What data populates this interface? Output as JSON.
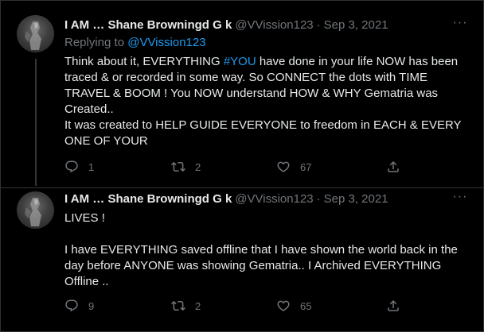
{
  "tweets": [
    {
      "author": {
        "name": "I AM … Shane Browningd G k",
        "handle": "@VVission123"
      },
      "separator": "·",
      "date": "Sep 3, 2021",
      "more_label": "···",
      "replying": {
        "prefix": "Replying to ",
        "mention": "@VVission123"
      },
      "text": {
        "before_hashtag": "Think about it, EVERYTHING ",
        "hashtag": "#YOU",
        "after_hashtag": " have done in your life NOW has been\ntraced & or recorded in some way. So CONNECT the dots with TIME\nTRAVEL & BOOM ! You NOW understand HOW & WHY Gematria was\nCreated..\nIt was created to HELP GUIDE EVERYONE to freedom in EACH & EVERY\nONE OF YOUR"
      },
      "actions": {
        "replies": "1",
        "retweets": "2",
        "likes": "67"
      }
    },
    {
      "author": {
        "name": "I AM … Shane Browningd G k",
        "handle": "@VVission123"
      },
      "separator": "·",
      "date": "Sep 3, 2021",
      "more_label": "···",
      "text": {
        "body": "LIVES !\n\nI have EVERYTHING saved offline that I have shown the world back in the\nday before ANYONE was showing Gematria.. I Archived EVERYTHING\nOffline .."
      },
      "actions": {
        "replies": "9",
        "retweets": "2",
        "likes": "65"
      }
    }
  ],
  "icons": [
    "reply-icon",
    "retweet-icon",
    "like-icon",
    "share-icon",
    "more-icon"
  ],
  "colors": {
    "background": "#000000",
    "text": "#e7e9ea",
    "muted": "#71767b",
    "link": "#1d9bf0",
    "border": "#2f3336"
  }
}
